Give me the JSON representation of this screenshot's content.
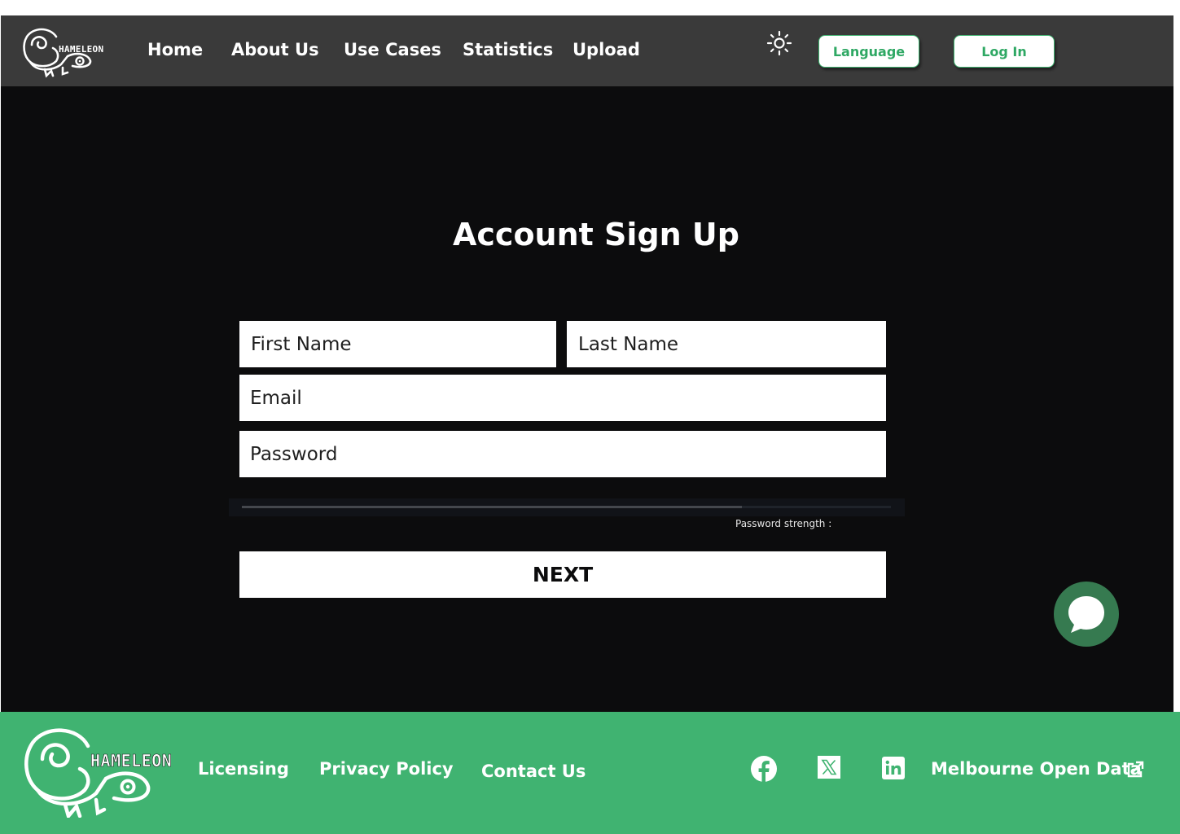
{
  "header": {
    "logo_text": "HAMELEON",
    "nav": [
      "Home",
      "About Us",
      "Use Cases",
      "Statistics",
      "Upload"
    ],
    "theme_icon": "sun-icon",
    "language_label": "Language",
    "login_label": "Log In"
  },
  "form": {
    "title": "Account Sign Up",
    "first_name_placeholder": "First Name",
    "last_name_placeholder": "Last Name",
    "email_placeholder": "Email",
    "password_placeholder": "Password",
    "password_strength_label": "Password strength :",
    "password_strength_fraction": 0.77,
    "next_label": "NEXT"
  },
  "chat": {
    "icon": "chat-bubble-icon"
  },
  "footer": {
    "logo_text": "HAMELEON",
    "links": [
      "Licensing",
      "Privacy Policy",
      "Contact Us"
    ],
    "social_icons": [
      "facebook-icon",
      "x-icon",
      "linkedin-icon"
    ],
    "external_link_label": "Melbourne Open Data",
    "external_icon": "external-link-icon"
  },
  "colors": {
    "header_bg": "#3a3a3a",
    "main_bg": "#0c0c0d",
    "footer_bg": "#40b371",
    "accent_green": "#2fa864",
    "chat_bg": "#367a50"
  }
}
